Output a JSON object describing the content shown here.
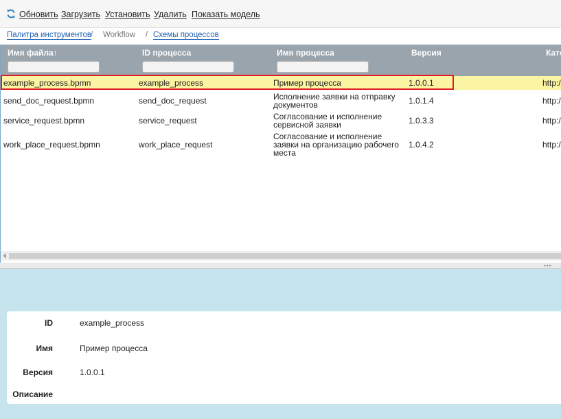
{
  "toolbar": {
    "refresh_icon": "refresh-icon",
    "buttons": [
      "Обновить",
      "Загрузить",
      "Установить",
      "Удалить",
      "Показать модель"
    ]
  },
  "breadcrumb": {
    "items": [
      "Палитра инструментов",
      "Workflow",
      "Схемы процессов"
    ],
    "separator": "/"
  },
  "grid": {
    "columns": [
      "Имя файла↑",
      "ID процесса",
      "Имя процесса",
      "Версия",
      "Кате"
    ],
    "rows": [
      {
        "file": "example_process.bpmn",
        "id": "example_process",
        "name": "Пример процесса",
        "version": "1.0.0.1",
        "category": "http:/"
      },
      {
        "file": "send_doc_request.bpmn",
        "id": "send_doc_request",
        "name": "Исполнение заявки на отправку документов",
        "version": "1.0.1.4",
        "category": "http:/"
      },
      {
        "file": "service_request.bpmn",
        "id": "service_request",
        "name": "Согласование и исполнение сервисной заявки",
        "version": "1.0.3.3",
        "category": "http:/"
      },
      {
        "file": "work_place_request.bpmn",
        "id": "work_place_request",
        "name": "Согласование и исполнение заявки на организацию рабочего места",
        "version": "1.0.4.2",
        "category": "http:/"
      }
    ],
    "selected_index": 0
  },
  "detail": {
    "fields": [
      {
        "label": "ID",
        "value": "example_process"
      },
      {
        "label": "Имя",
        "value": "Пример процесса"
      },
      {
        "label": "Версия",
        "value": "1.0.0.1"
      },
      {
        "label": "Описание",
        "value": ""
      }
    ]
  },
  "colors": {
    "header_bg": "#9aa4ac",
    "selected_row_bg": "#fbf4a2",
    "selection_frame": "#e11a22",
    "panel_bg": "#c5e4ee",
    "link": "#1f62b5"
  }
}
